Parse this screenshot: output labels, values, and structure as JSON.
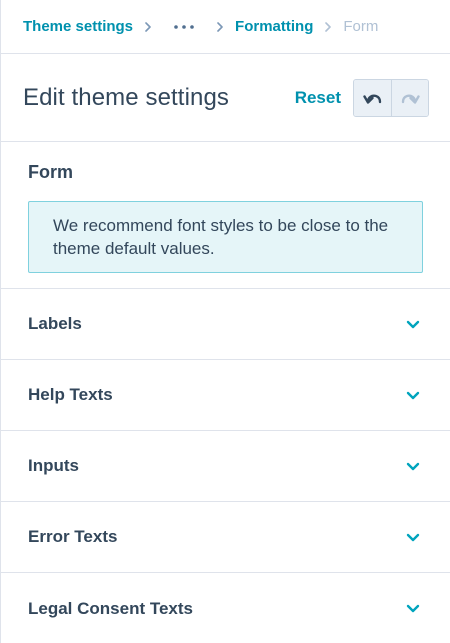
{
  "breadcrumb": {
    "items": [
      "Theme settings",
      "Formatting"
    ],
    "current": "Form"
  },
  "header": {
    "title": "Edit theme settings",
    "reset_label": "Reset"
  },
  "form": {
    "title": "Form",
    "notice": "We recommend font styles to be close to the theme default values."
  },
  "sections": [
    {
      "label": "Labels"
    },
    {
      "label": "Help Texts"
    },
    {
      "label": "Inputs"
    },
    {
      "label": "Error Texts"
    },
    {
      "label": "Legal Consent Texts"
    }
  ],
  "colors": {
    "accent": "#0091ae",
    "text": "#33475b",
    "muted": "#b0c1d4",
    "notice_bg": "#e5f5f8",
    "notice_border": "#7fd1de",
    "divider": "#dfe3eb"
  }
}
